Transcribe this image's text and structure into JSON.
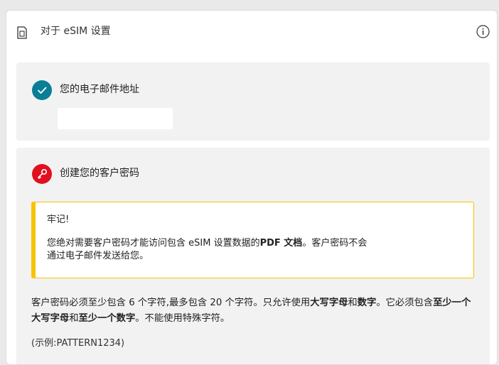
{
  "header": {
    "title": "对于 eSIM 设置",
    "sim_icon": "sim-card-icon",
    "info_icon": "info-icon"
  },
  "email_step": {
    "title": "您的电子邮件地址",
    "icon": "check-icon",
    "icon_color": "#0a7e96",
    "input_value": ""
  },
  "password_step": {
    "title": "创建您的客户密码",
    "icon": "key-icon",
    "icon_color": "#e0101e",
    "notice": {
      "title": "牢记!",
      "body_part1": "您绝对需要客户密码才能访问包含 eSIM 设置数据的",
      "body_bold": "PDF 文档",
      "body_part2": "。客户密码不会",
      "body_part3": "通过电子邮件发送给您。",
      "border_color": "#f6c400"
    },
    "rules": {
      "p1": "客户密码必须至少包含 6 个字符,最多包含 20 个字符。只允许使用",
      "b1": "大写字母",
      "p2": "和",
      "b2": "数字",
      "p3": "。它必须包含",
      "b3": "至少一个大写字母",
      "p4": "和",
      "b4": "至少一个数字",
      "p5": "。不能使用特殊字符。"
    },
    "example": "(示例:PATTERN1234)"
  }
}
